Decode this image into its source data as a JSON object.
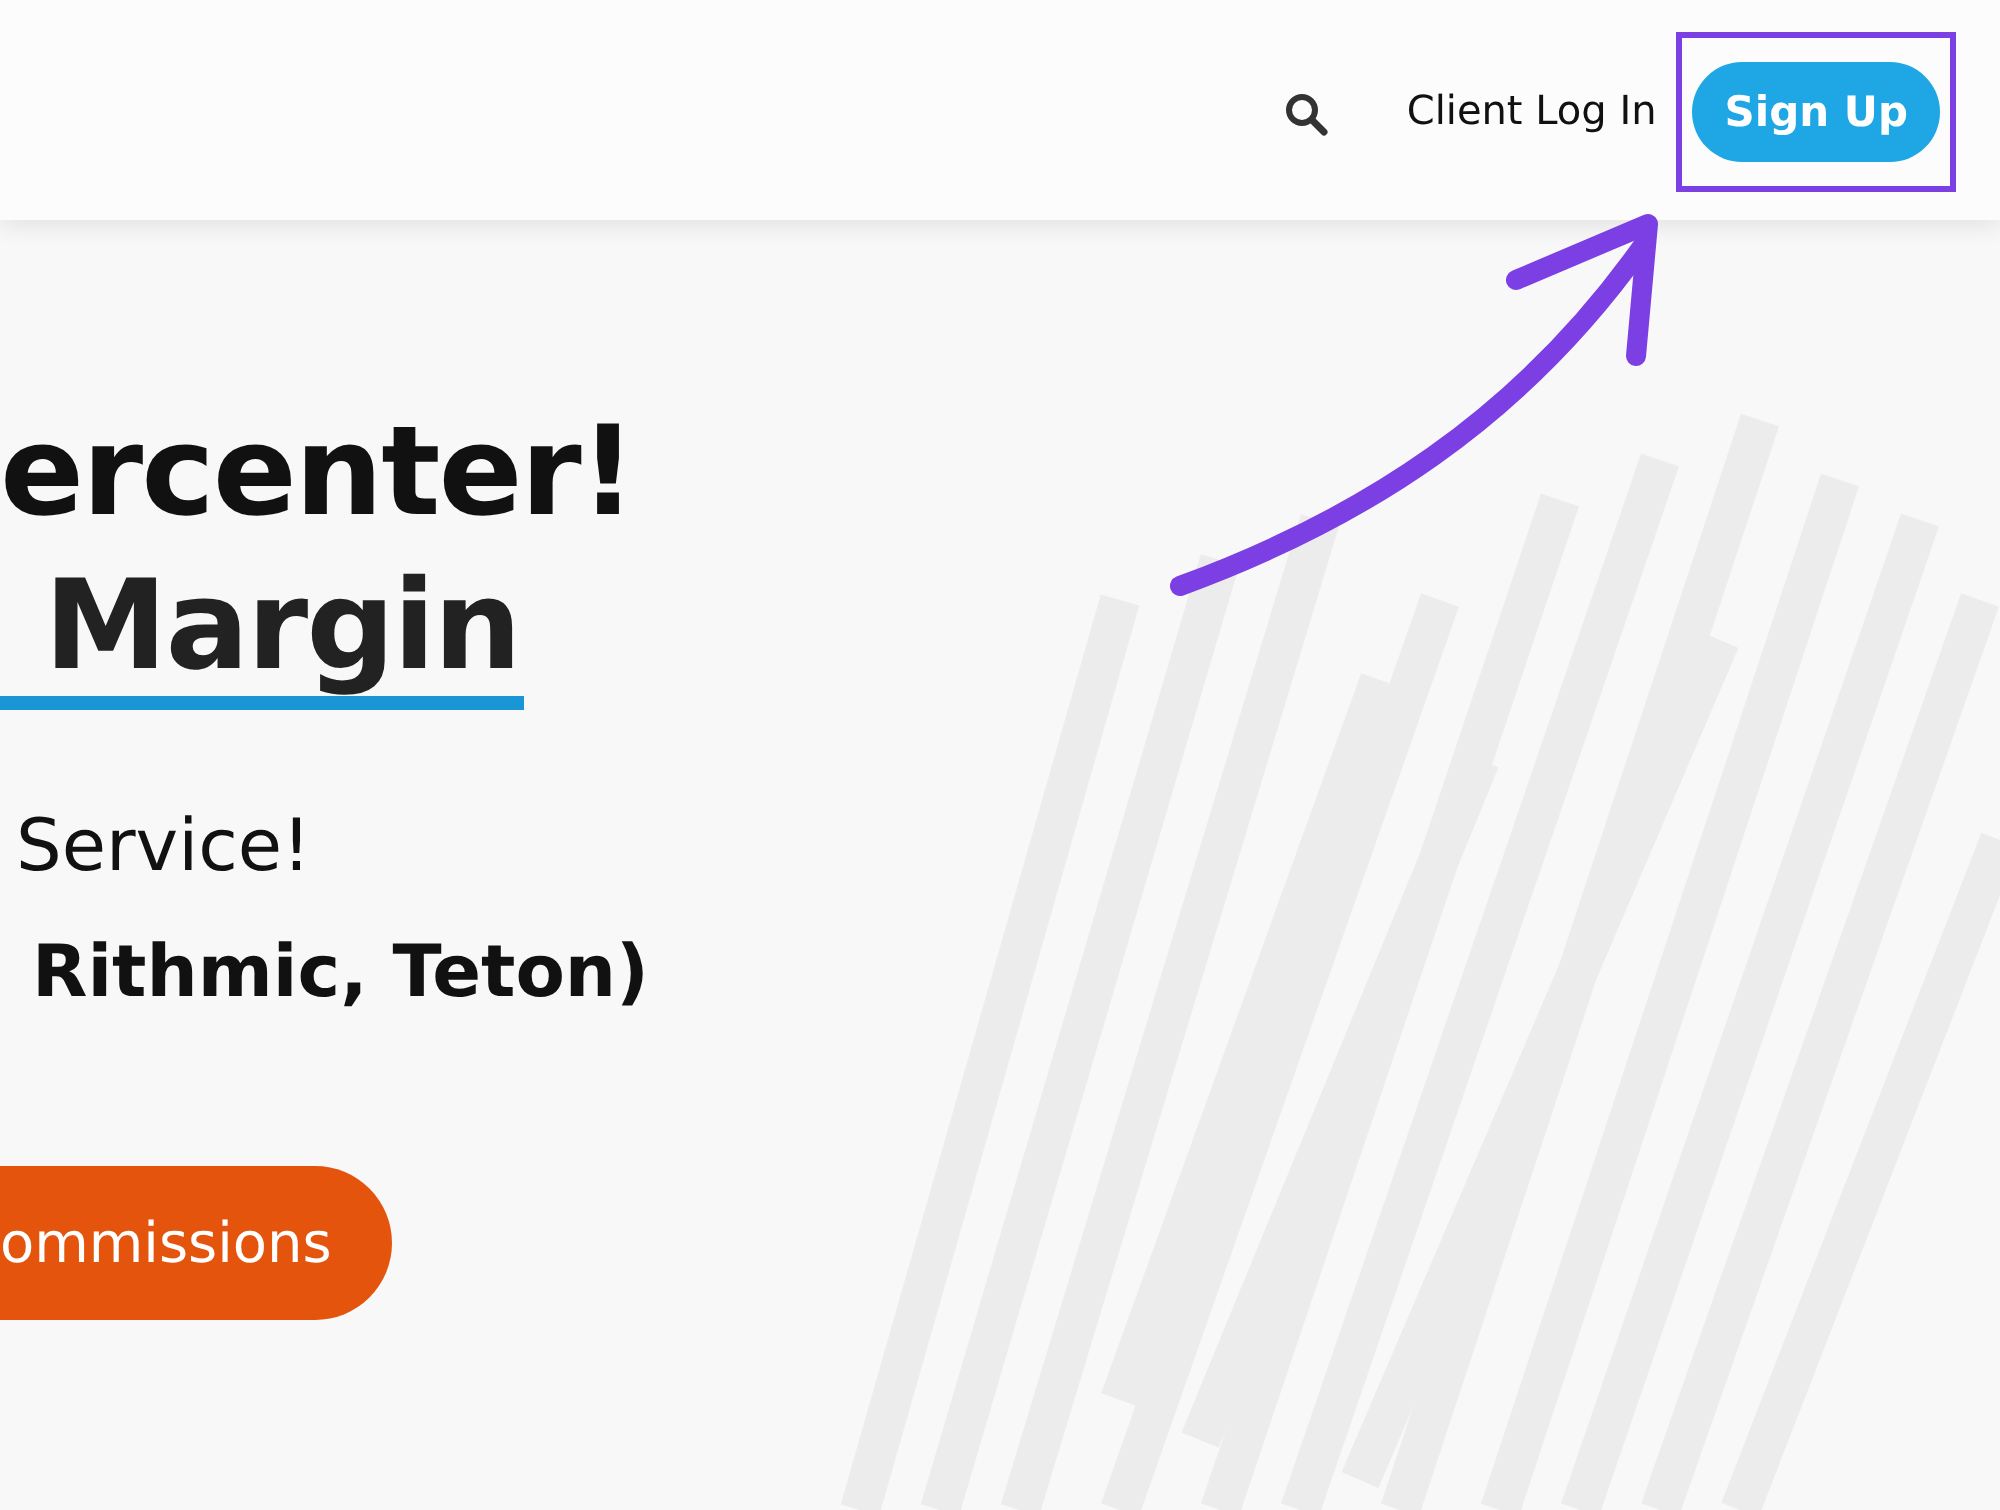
{
  "header": {
    "nav": [
      {
        "kind": "link",
        "label": "Client Log In"
      },
      {
        "kind": "button",
        "label": "Sign Up"
      }
    ]
  },
  "hero": {
    "heading": "ercenter!",
    "heading_highlight": "Margin",
    "tagline": "Service!",
    "platforms": "Rithmic, Teton)",
    "cta": "ommissions"
  }
}
